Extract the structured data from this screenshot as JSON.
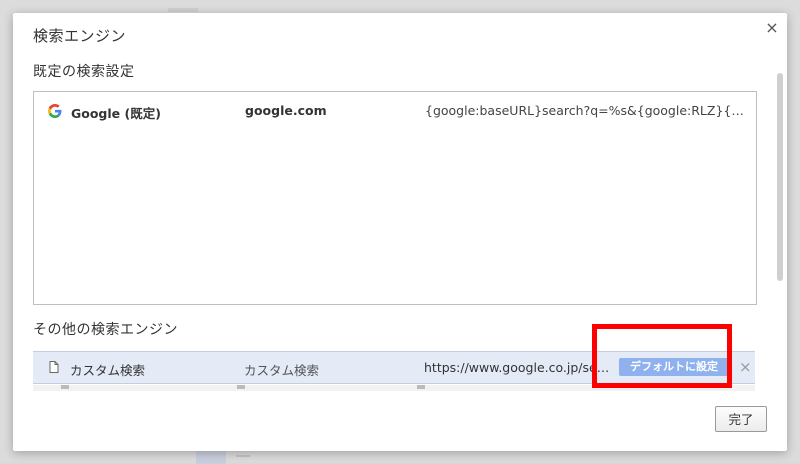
{
  "dialog": {
    "title": "検索エンジン",
    "close_glyph": "×",
    "done_label": "完了"
  },
  "default_section": {
    "title": "既定の検索設定",
    "engines": [
      {
        "icon": "google-logo-icon",
        "name": "Google (既定)",
        "keyword": "google.com",
        "url": "{google:baseURL}search?q=%s&{google:RLZ}{go…"
      }
    ]
  },
  "other_section": {
    "title": "その他の検索エンジン",
    "engines": [
      {
        "icon": "page-icon",
        "name": "カスタム検索",
        "keyword": "カスタム検索",
        "url": "https://www.google.co.jp/sear…",
        "set_default_label": "デフォルトに設定",
        "delete_glyph": "×"
      }
    ]
  },
  "colors": {
    "highlight": "#ff0000",
    "set_default_button": "#8fb1ee",
    "selected_row": "#e4ebf7"
  }
}
